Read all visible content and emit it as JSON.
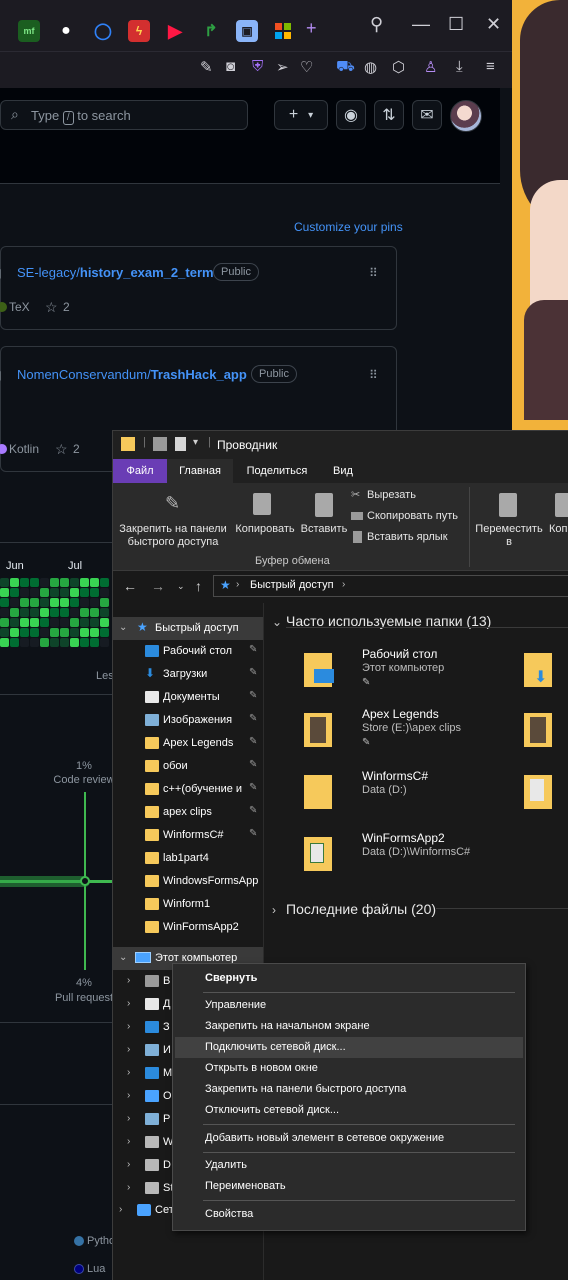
{
  "browser": {
    "tab_icons": [
      "mf-icon",
      "globe-icon",
      "circle-icon",
      "lightning-icon",
      "play-icon",
      "arrow-icon",
      "puzzle-icon",
      "windows-icon"
    ],
    "new_tab": "+",
    "search": {
      "placeholder_prefix": "Type",
      "key": "/",
      "placeholder_suffix": "to search"
    },
    "header_buttons": [
      "+",
      "▾",
      "◉",
      "⇅",
      "✉"
    ]
  },
  "github": {
    "customize_pins": "Customize your pins",
    "pins": [
      {
        "owner": "SE-legacy",
        "repo": "history_exam_2_term",
        "visibility": "Public",
        "language": "TeX",
        "lang_color": "#3d6117",
        "stars": "2"
      },
      {
        "owner": "NomenConservandum",
        "repo": "TrashHack_app",
        "visibility": "Public",
        "language": "Kotlin",
        "lang_color": "#a97bff",
        "stars": "2"
      }
    ],
    "months": [
      "Jun",
      "Jul"
    ],
    "less_label": "Les",
    "activity": {
      "code_review_pct": "1%",
      "code_review_label": "Code review",
      "pull_request_pct": "4%",
      "pull_request_label": "Pull request"
    },
    "languages": [
      {
        "name": "Pytho",
        "color": "#3572A5"
      },
      {
        "name": "Lua",
        "color": "#000080"
      }
    ]
  },
  "explorer": {
    "title": "Проводник",
    "tabs": [
      "Файл",
      "Главная",
      "Поделиться",
      "Вид"
    ],
    "ribbon": {
      "pin_quick": "Закрепить на панели быстрого доступа",
      "copy": "Копировать",
      "paste": "Вставить",
      "cut": "Вырезать",
      "copy_path": "Скопировать путь",
      "paste_shortcut": "Вставить ярлык",
      "clipboard_group": "Буфер обмена",
      "move": "Переместить в",
      "copy2": "Копи"
    },
    "address": "Быстрый доступ",
    "nav": {
      "quick_access": "Быстрый доступ",
      "items": [
        "Рабочий стол",
        "Загрузки",
        "Документы",
        "Изображения",
        "Apex Legends",
        "обои",
        "c++(обучение и",
        "apex clips",
        "WinformsC#",
        "lab1part4",
        "WindowsFormsApp",
        "Winform1",
        "WinFormsApp2"
      ],
      "this_pc": "Этот компьютер",
      "pc_items": [
        "В",
        "Д",
        "З",
        "И",
        "М",
        "О",
        "Р",
        "W",
        "D",
        "St"
      ],
      "network": "Сет"
    },
    "frequent_header": "Часто используемые папки (13)",
    "frequent": [
      {
        "name": "Рабочий стол",
        "sub": "Этот компьютер"
      },
      {
        "name": "Apex Legends",
        "sub": "Store (E:)\\apex clips"
      },
      {
        "name": "WinformsC#",
        "sub": "Data (D:)"
      },
      {
        "name": "WinFormsApp2",
        "sub": "Data (D:)\\WinformsC#"
      }
    ],
    "recent_header": "Последние файлы (20)"
  },
  "context_menu": {
    "items": [
      "Свернуть",
      "Управление",
      "Закрепить на начальном экране",
      "Подключить сетевой диск...",
      "Открыть в новом окне",
      "Закрепить на панели быстрого доступа",
      "Отключить сетевой диск...",
      "Добавить новый элемент в сетевое окружение",
      "Удалить",
      "Переименовать",
      "Свойства"
    ]
  }
}
